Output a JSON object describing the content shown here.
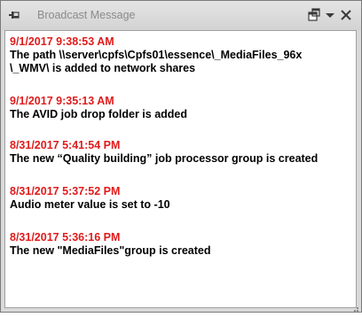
{
  "window": {
    "title": "Broadcast Message"
  },
  "titlebar_icons": {
    "pin": "pin-icon",
    "options": "window-options-icon",
    "dropdown": "chevron-down-icon",
    "close": "close-icon"
  },
  "colors": {
    "timestamp": "#e01b1b",
    "message_text": "#000000",
    "title_text": "#8b8b8b"
  },
  "messages": [
    {
      "time": "9/1/2017 9:38:53 AM",
      "lines": [
        "The path \\\\server\\cpfs\\Cpfs01\\essence\\_MediaFiles_96x",
        "\\_WMV\\ is added to network shares"
      ]
    },
    {
      "time": "9/1/2017 9:35:13 AM",
      "lines": [
        "The AVID job drop folder is added"
      ]
    },
    {
      "time": "8/31/2017 5:41:54 PM",
      "lines": [
        "The new “Quality building” job processor group is created"
      ]
    },
    {
      "time": "8/31/2017 5:37:52 PM",
      "lines": [
        "Audio meter value is set to -10"
      ]
    },
    {
      "time": "8/31/2017 5:36:16 PM",
      "lines": [
        "The new \"MediaFiles\"group is created"
      ]
    }
  ]
}
